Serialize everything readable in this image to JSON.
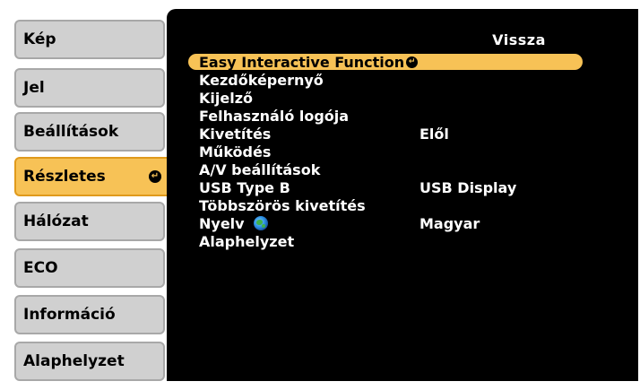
{
  "menu": {
    "tabs": [
      {
        "label": "Kép",
        "active": false
      },
      {
        "label": "Jel",
        "active": false
      },
      {
        "label": "Beállítások",
        "active": false
      },
      {
        "label": "Részletes",
        "active": true
      },
      {
        "label": "Hálózat",
        "active": false
      },
      {
        "label": "ECO",
        "active": false
      },
      {
        "label": "Információ",
        "active": false
      },
      {
        "label": "Alaphelyzet",
        "active": false
      }
    ]
  },
  "panel": {
    "back_label": "Vissza",
    "items": [
      {
        "label": "Easy Interactive Function",
        "value": "",
        "selected": true
      },
      {
        "label": "Kezdőképernyő",
        "value": ""
      },
      {
        "label": "Kijelző",
        "value": ""
      },
      {
        "label": "Felhasználó logója",
        "value": ""
      },
      {
        "label": "Kivetítés",
        "value": "Elől"
      },
      {
        "label": "Működés",
        "value": ""
      },
      {
        "label": "A/V beállítások",
        "value": ""
      },
      {
        "label": "USB Type B",
        "value": "USB Display"
      },
      {
        "label": "Többszörös kivetítés",
        "value": ""
      },
      {
        "label": "Nyelv",
        "value": "Magyar"
      },
      {
        "label": "Alaphelyzet",
        "value": ""
      }
    ]
  },
  "icons": {
    "enter": "enter-icon",
    "language": "globe-icon"
  },
  "colors": {
    "accent": "#f7c256",
    "tab_bg": "#d0d0d0",
    "panel_bg": "#000000"
  }
}
